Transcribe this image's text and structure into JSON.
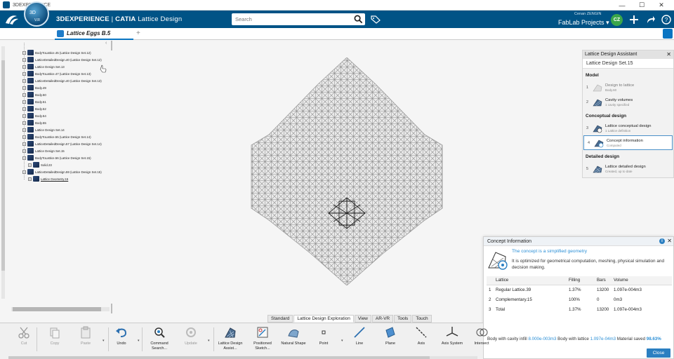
{
  "window": {
    "title": "3DEXPERIENCE",
    "controls": [
      "—",
      "☐",
      "✕"
    ]
  },
  "topbar": {
    "compass_label": "3D",
    "compass_sub": "V.R",
    "app_brand": "3DEXPERIENCE",
    "app_sep": " | ",
    "app_product": "CATIA",
    "app_name": "Lattice Design",
    "search_placeholder": "Search",
    "user_name": "Cenan ZENGIN",
    "project": "FabLab Projects",
    "avatar_initials": "CZ"
  },
  "tabs": {
    "document": "Lattice Eggs B.5",
    "add": "+"
  },
  "tree": {
    "items": [
      {
        "label": "BodyToLattice.45 (Lattice Design Set.12)"
      },
      {
        "label": "LatticeDetailedDesign.40 (Lattice Design Set.12)"
      },
      {
        "label": "Lattice Design Set.13"
      },
      {
        "label": "BodyToLattice.47 (Lattice Design Set.13)"
      },
      {
        "label": "LatticeDetailedDesign.40 (Lattice Design Set.13)"
      },
      {
        "label": "Body.49"
      },
      {
        "label": "Body.50"
      },
      {
        "label": "Body.51"
      },
      {
        "label": "Body.52"
      },
      {
        "label": "Body.54"
      },
      {
        "label": "Body.55"
      },
      {
        "label": "Lattice Design Set.14"
      },
      {
        "label": "BodyToLattice.55 (Lattice Design Set.14)"
      },
      {
        "label": "LatticeDetailedDesign.57 (Lattice Design Set.14)"
      },
      {
        "label": "Lattice Design Set.15"
      },
      {
        "label": "BodyToLattice.56 (Lattice Design Set.15)"
      },
      {
        "label": "Solid.23"
      },
      {
        "label": "LatticeDetailedDesign.59 (Lattice Design Set.15)"
      },
      {
        "label": "Lattice Geometry.15"
      }
    ]
  },
  "assistant": {
    "title": "Lattice Design Assistant",
    "subtitle": "Lattice Design Set.15",
    "sections": {
      "model": "Model",
      "conceptual": "Conceptual design",
      "detailed": "Detailed design"
    },
    "steps": [
      {
        "num": "1",
        "title": "Design to lattice",
        "sub": "Body.60"
      },
      {
        "num": "2",
        "title": "Cavity volumes",
        "sub": "1 cavity specified"
      },
      {
        "num": "3",
        "title": "Lattice conceptual design",
        "sub": "1 Lattice definition"
      },
      {
        "num": "4",
        "title": "Concept information",
        "sub": "Computed"
      },
      {
        "num": "5",
        "title": "Lattice detailed design",
        "sub": "Created, up to date"
      }
    ]
  },
  "concept": {
    "title": "Concept Information",
    "headline": "The concept is a simplified geometry",
    "description": "It is optimized for geometrical computation, meshing, physical simulation and decision making.",
    "columns": [
      "",
      "Lattice",
      "Filling",
      "Bars",
      "Volume"
    ],
    "rows": [
      {
        "idx": "1",
        "lattice": "Regular Lattice.39",
        "filling": "1.37%",
        "bars": "13200",
        "volume": "1.097e-004m3"
      },
      {
        "idx": "2",
        "lattice": "Complementary.15",
        "filling": "100%",
        "bars": "0",
        "volume": "0m3"
      },
      {
        "idx": "3",
        "lattice": "Total",
        "filling": "1.37%",
        "bars": "13200",
        "volume": "1.097e-004m3"
      }
    ],
    "footer": {
      "cavity_label": "Body with cavity infill",
      "cavity_value": "8.000e-003m3",
      "lattice_label": "Body with lattice",
      "lattice_value": "1.097e-04m3",
      "saved_label": "Material saved",
      "saved_value": "98.63%"
    },
    "close": "Close"
  },
  "toolbar_tabs": [
    "Standard",
    "Lattice Design Exploration",
    "View",
    "AR-VR",
    "Tools",
    "Touch"
  ],
  "actions": [
    {
      "label": "Cut",
      "icon": "scissors-icon"
    },
    {
      "label": "Copy",
      "icon": "copy-icon"
    },
    {
      "label": "Paste",
      "icon": "paste-icon"
    },
    {
      "label": "Undo",
      "icon": "undo-icon"
    },
    {
      "label": "Command Search...",
      "icon": "command-search-icon"
    },
    {
      "label": "Update",
      "icon": "update-icon"
    },
    {
      "label": "Lattice Design Assist...",
      "icon": "lattice-assist-icon"
    },
    {
      "label": "Positioned Sketch...",
      "icon": "sketch-icon"
    },
    {
      "label": "Natural Shape",
      "icon": "natural-shape-icon"
    },
    {
      "label": "Point",
      "icon": "point-icon"
    },
    {
      "label": "Line",
      "icon": "line-icon"
    },
    {
      "label": "Plane",
      "icon": "plane-icon"
    },
    {
      "label": "Axis",
      "icon": "axis-icon"
    },
    {
      "label": "Axis System",
      "icon": "axis-system-icon"
    },
    {
      "label": "Intersect",
      "icon": "intersect-icon"
    }
  ],
  "colors": {
    "brand": "#005386",
    "accent": "#2b8fd6",
    "button": "#2b7fc1"
  }
}
